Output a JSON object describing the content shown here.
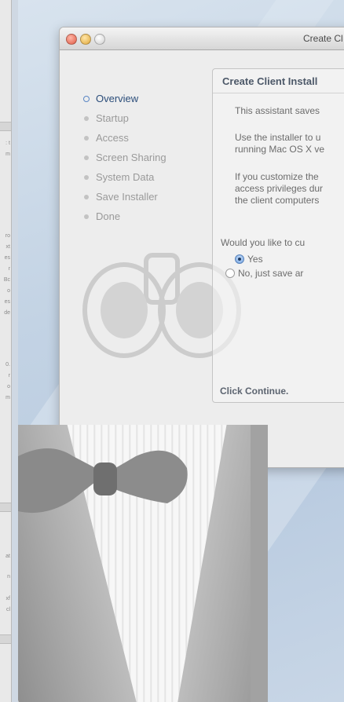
{
  "window": {
    "title": "Create Cl"
  },
  "steps": [
    {
      "label": "Overview",
      "current": true
    },
    {
      "label": "Startup",
      "current": false
    },
    {
      "label": "Access",
      "current": false
    },
    {
      "label": "Screen Sharing",
      "current": false
    },
    {
      "label": "System Data",
      "current": false
    },
    {
      "label": "Save Installer",
      "current": false
    },
    {
      "label": "Done",
      "current": false
    }
  ],
  "pane": {
    "title": "Create Client Install",
    "intro": "This assistant saves",
    "use_line1": "Use the installer to u",
    "use_line2": "running Mac OS X ve",
    "customize_line1": "If you customize the",
    "customize_line2": "access privileges dur",
    "customize_line3": "the client computers",
    "question": "Would you like to cu",
    "option_yes": "Yes",
    "option_no": "No, just save ar",
    "selected_option": "yes",
    "footer": "Click Continue."
  },
  "icons": {
    "close": "close-icon",
    "minimize": "minimize-icon",
    "zoom": "zoom-icon",
    "watermark": "binoculars-icon",
    "app_icon": "tuxedo-bowtie-icon"
  },
  "colors": {
    "current_step": "#2b4d7a",
    "inactive_step": "#9a9a9a",
    "close_button": "#e05a44",
    "minimize_button": "#e0a73a"
  }
}
